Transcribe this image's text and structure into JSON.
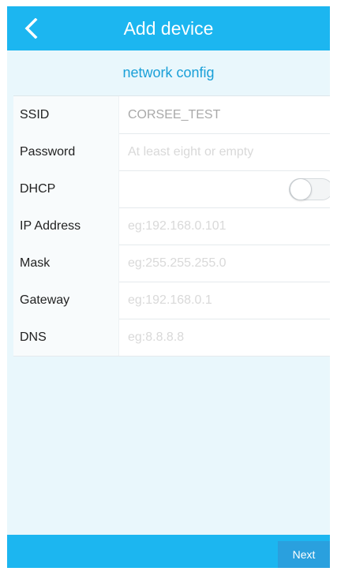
{
  "header": {
    "title": "Add device",
    "back_icon": "chevron-left-icon"
  },
  "section_title": "network config",
  "fields": [
    {
      "label": "SSID",
      "value": "CORSEE_TEST",
      "placeholder": ""
    },
    {
      "label": "Password",
      "value": "",
      "placeholder": "At least eight or empty"
    },
    {
      "label": "DHCP",
      "toggle_on": false
    },
    {
      "label": "IP Address",
      "value": "",
      "placeholder": "eg:192.168.0.101"
    },
    {
      "label": "Mask",
      "value": "",
      "placeholder": "eg:255.255.255.0"
    },
    {
      "label": "Gateway",
      "value": "",
      "placeholder": "eg:192.168.0.1"
    },
    {
      "label": "DNS",
      "value": "",
      "placeholder": "eg:8.8.8.8"
    }
  ],
  "footer": {
    "next_label": "Next"
  },
  "colors": {
    "accent": "#1cb6f0",
    "background": "#e9f7fc",
    "subtitle": "#1aa0d8"
  }
}
